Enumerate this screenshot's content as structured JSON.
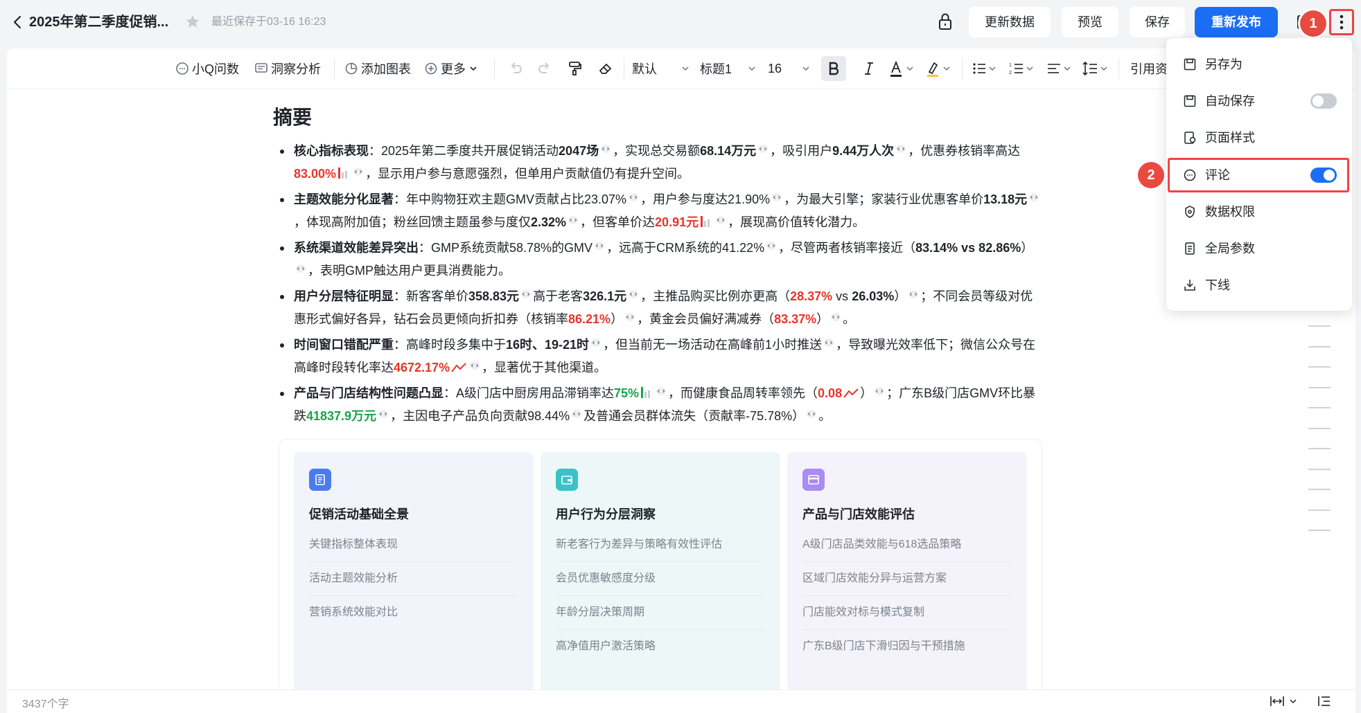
{
  "header": {
    "title": "2025年第二季度促销...",
    "save_status": "最近保存于03-16 16:23",
    "buttons": {
      "update_data": "更新数据",
      "preview": "预览",
      "save": "保存",
      "republish": "重新发布"
    },
    "markers": [
      "1",
      "2"
    ]
  },
  "toolbar": {
    "ask_q": "小Q问数",
    "insight": "洞察分析",
    "add_chart": "添加图表",
    "more": "更多",
    "style_default": "默认",
    "heading": "标题1",
    "font_size": "16",
    "cite": "引用资"
  },
  "document": {
    "summary_title": "摘要",
    "bullets": [
      {
        "label": "核心指标表现",
        "t1": "：2025年第二季度共开展促销活动",
        "v1": "2047场",
        "t2": "，实现总交易额",
        "v2": "68.14万元",
        "t3": "，吸引用户",
        "v3": "9.44万人次",
        "t4": "，优惠券核销率高达",
        "v4": "83.00%",
        "t5": "，显示用户参与意愿强烈，但单用户贡献值仍有提升空间。"
      },
      {
        "label": "主题效能分化显著",
        "t1": "：年中购物狂欢主题GMV贡献占比23.07%",
        "t2": "，用户参与度达21.90%",
        "t3": "，为最大引擎；家装行业优惠客单价",
        "v1": "13.18元",
        "t4": "，体现高附加值；粉丝回馈主题虽参与度仅",
        "v2": "2.32%",
        "t5": "，但客单价达",
        "v3": "20.91元",
        "t6": "，展现高价值转化潜力。"
      },
      {
        "label": "系统渠道效能差异突出",
        "t1": "：GMP系统贡献58.78%的GMV",
        "t2": "，远高于CRM系统的41.22%",
        "t3": "，尽管两者核销率接近（",
        "v1": "83.14% vs 82.86%",
        "t4": "）",
        "t5": "，表明GMP触达用户更具消费能力。"
      },
      {
        "label": "用户分层特征明显",
        "t1": "：新客客单价",
        "v1": "358.83元",
        "t2": "高于老客",
        "v2": "326.1元",
        "t3": "，主推品购买比例亦更高（",
        "v3": "28.37%",
        "t4": " vs ",
        "v4": "26.03%",
        "t5": "）",
        "t6": "；不同会员等级对优惠形式偏好各异，钻石会员更倾向折扣券（核销率",
        "v5": "86.21%",
        "t7": "）",
        "t8": "，黄金会员偏好满减券（",
        "v6": "83.37%",
        "t9": "）",
        "t10": "。"
      },
      {
        "label": "时间窗口错配严重",
        "t1": "：高峰时段多集中于",
        "v1": "16时、19-21时",
        "t2": "，但当前无一场活动在高峰前1小时推送",
        "t3": "，导致曝光效率低下；微信公众号在高峰时段转化率达",
        "v2": "4672.17%",
        "t4": "，显著优于其他渠道。"
      },
      {
        "label": "产品与门店结构性问题凸显",
        "t1": "：A级门店中厨房用品滞销率达",
        "v1": "75%",
        "t2": "，而健康食品周转率领先（",
        "v2": "0.08",
        "t3": "）",
        "t4": "；广东B级门店GMV环比暴跌",
        "v3": "41837.9万元",
        "t5": "，主因电子产品负向贡献98.44%",
        "t6": "及普通会员群体流失（贡献率-75.78%）",
        "t7": "。"
      }
    ],
    "sections": [
      {
        "title": "促销活动基础全景",
        "items": [
          "关键指标整体表现",
          "活动主题效能分析",
          "营销系统效能对比"
        ]
      },
      {
        "title": "用户行为分层洞察",
        "items": [
          "新老客行为差异与策略有效性评估",
          "会员优惠敏感度分级",
          "年龄分层决策周期",
          "高净值用户激活策略"
        ]
      },
      {
        "title": "产品与门店效能评估",
        "items": [
          "A级门店品类效能与618选品策略",
          "区域门店效能分异与运营方案",
          "门店能效对标与模式复制",
          "广东B级门店下滑归因与干预措施"
        ]
      }
    ]
  },
  "menu": {
    "items": [
      {
        "label": "另存为",
        "icon": "save-as-icon"
      },
      {
        "label": "自动保存",
        "icon": "auto-save-icon",
        "toggle": false
      },
      {
        "label": "页面样式",
        "icon": "page-style-icon"
      },
      {
        "label": "评论",
        "icon": "comment-icon",
        "toggle": true
      },
      {
        "label": "数据权限",
        "icon": "data-permission-icon"
      },
      {
        "label": "全局参数",
        "icon": "global-params-icon"
      },
      {
        "label": "下线",
        "icon": "offline-icon"
      }
    ]
  },
  "status": {
    "word_count": "3437个字"
  },
  "colors": {
    "primary": "#1b6ef3",
    "highlight": "#e8352b",
    "positive": "#19a34a",
    "marker": "#e94a3f"
  }
}
